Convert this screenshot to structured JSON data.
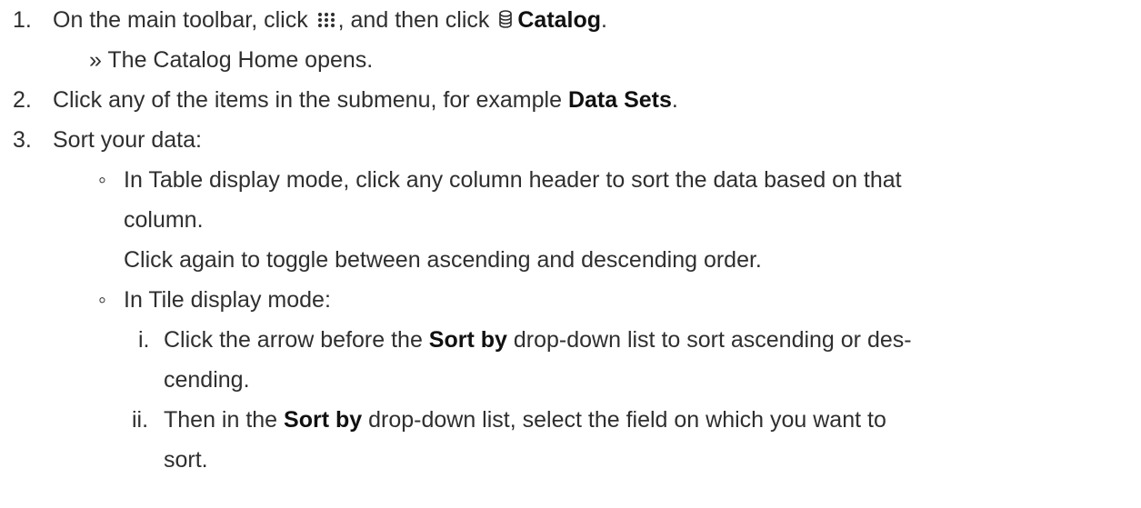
{
  "steps": [
    {
      "num": "1.",
      "pre": "On the main toolbar, click ",
      "icon1": "grid-dots-icon",
      "mid": ", and then click ",
      "icon2": "database-icon",
      "bold": "Catalog",
      "post": ".",
      "result": "» The Catalog Home opens."
    },
    {
      "num": "2.",
      "pre": "Click any of the items in the submenu, for example ",
      "bold": "Data Sets",
      "post": "."
    },
    {
      "num": "3.",
      "text": "Sort your data:",
      "bullet_table_l1": "In Table display mode, click any column header to sort the data based on that",
      "bullet_table_l2": "column.",
      "bullet_table_l3": "Click again to toggle between ascending and descending order.",
      "bullet_tile": "In Tile display mode:",
      "sub_i_num": "i.",
      "sub_i_pre": "Click the arrow before the ",
      "sub_i_bold": "Sort by",
      "sub_i_post": " drop-down list to sort ascending or des-",
      "sub_i_l2": "cending.",
      "sub_ii_num": "ii.",
      "sub_ii_pre": "Then in the ",
      "sub_ii_bold": "Sort by",
      "sub_ii_post": " drop-down list, select the field on which you want to",
      "sub_ii_l2": "sort."
    }
  ],
  "bullet_glyph": "◦"
}
